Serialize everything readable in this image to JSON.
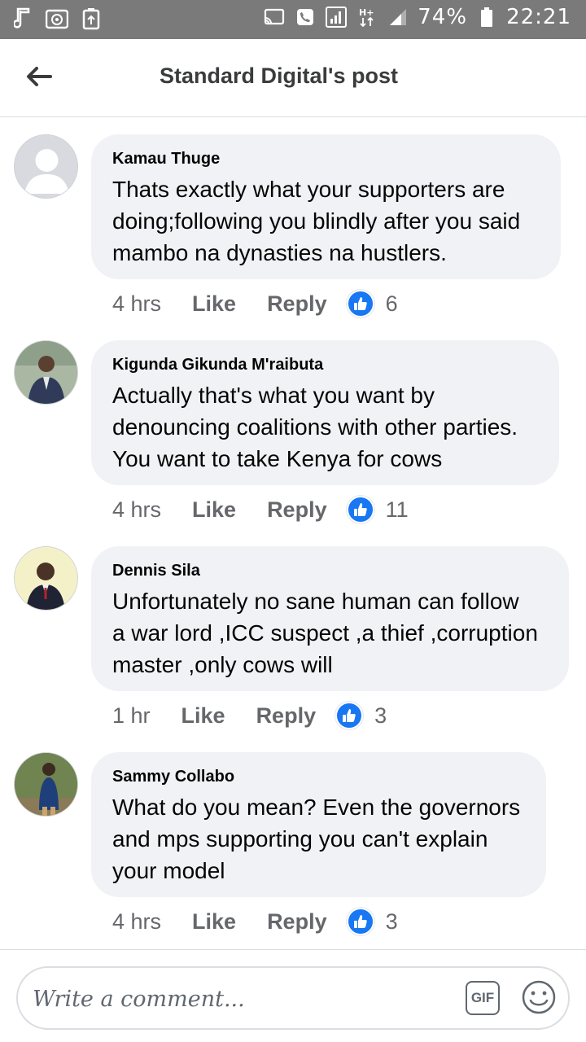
{
  "status_bar": {
    "battery_text": "74%",
    "time": "22:21",
    "left_icons": [
      "music-note-icon",
      "compass-icon",
      "battery-saver-icon"
    ],
    "right_icons": [
      "cast-icon",
      "phone-icon",
      "signal-box-icon",
      "hplus-data-icon",
      "signal-icon",
      "battery-icon"
    ]
  },
  "header": {
    "title": "Standard Digital's post",
    "back_icon": "arrow-left-icon"
  },
  "comments": [
    {
      "author": "Kamau Thuge",
      "line1": "Thats exactly what your supporters are",
      "line2": "doing;following you blindly after you said",
      "line3": "mambo na dynasties na hustlers.",
      "time": "4 hrs",
      "like_label": "Like",
      "reply_label": "Reply",
      "like_count": "6",
      "avatar": "default-avatar"
    },
    {
      "author": "Kigunda Gikunda M'raibuta",
      "line1": "Actually that's what you want by",
      "line2": "denouncing coalitions with other parties.",
      "line3": "You want to take Kenya for cows",
      "time": "4 hrs",
      "like_label": "Like",
      "reply_label": "Reply",
      "like_count": "11",
      "avatar": "photo-avatar"
    },
    {
      "author": "Dennis Sila",
      "line1": "Unfortunately no sane human can follow",
      "line2": "a war lord ,ICC suspect ,a thief ,corruption",
      "line3": "master ,only cows will",
      "time": "1 hr",
      "like_label": "Like",
      "reply_label": "Reply",
      "like_count": "3",
      "avatar": "photo-avatar"
    },
    {
      "author": "Sammy Collabo",
      "line1": "What do you mean? Even the governors",
      "line2": "and mps supporting you can't explain",
      "line3": "your model",
      "time": "4 hrs",
      "like_label": "Like",
      "reply_label": "Reply",
      "like_count": "3",
      "avatar": "photo-avatar"
    }
  ],
  "composer": {
    "placeholder": "Write a comment...",
    "gif_label": "GIF"
  },
  "colors": {
    "status_bar": "#7a7a7a",
    "bubble": "#f0f2f5",
    "like_blue": "#1877f2",
    "secondary_text": "#65676b"
  }
}
